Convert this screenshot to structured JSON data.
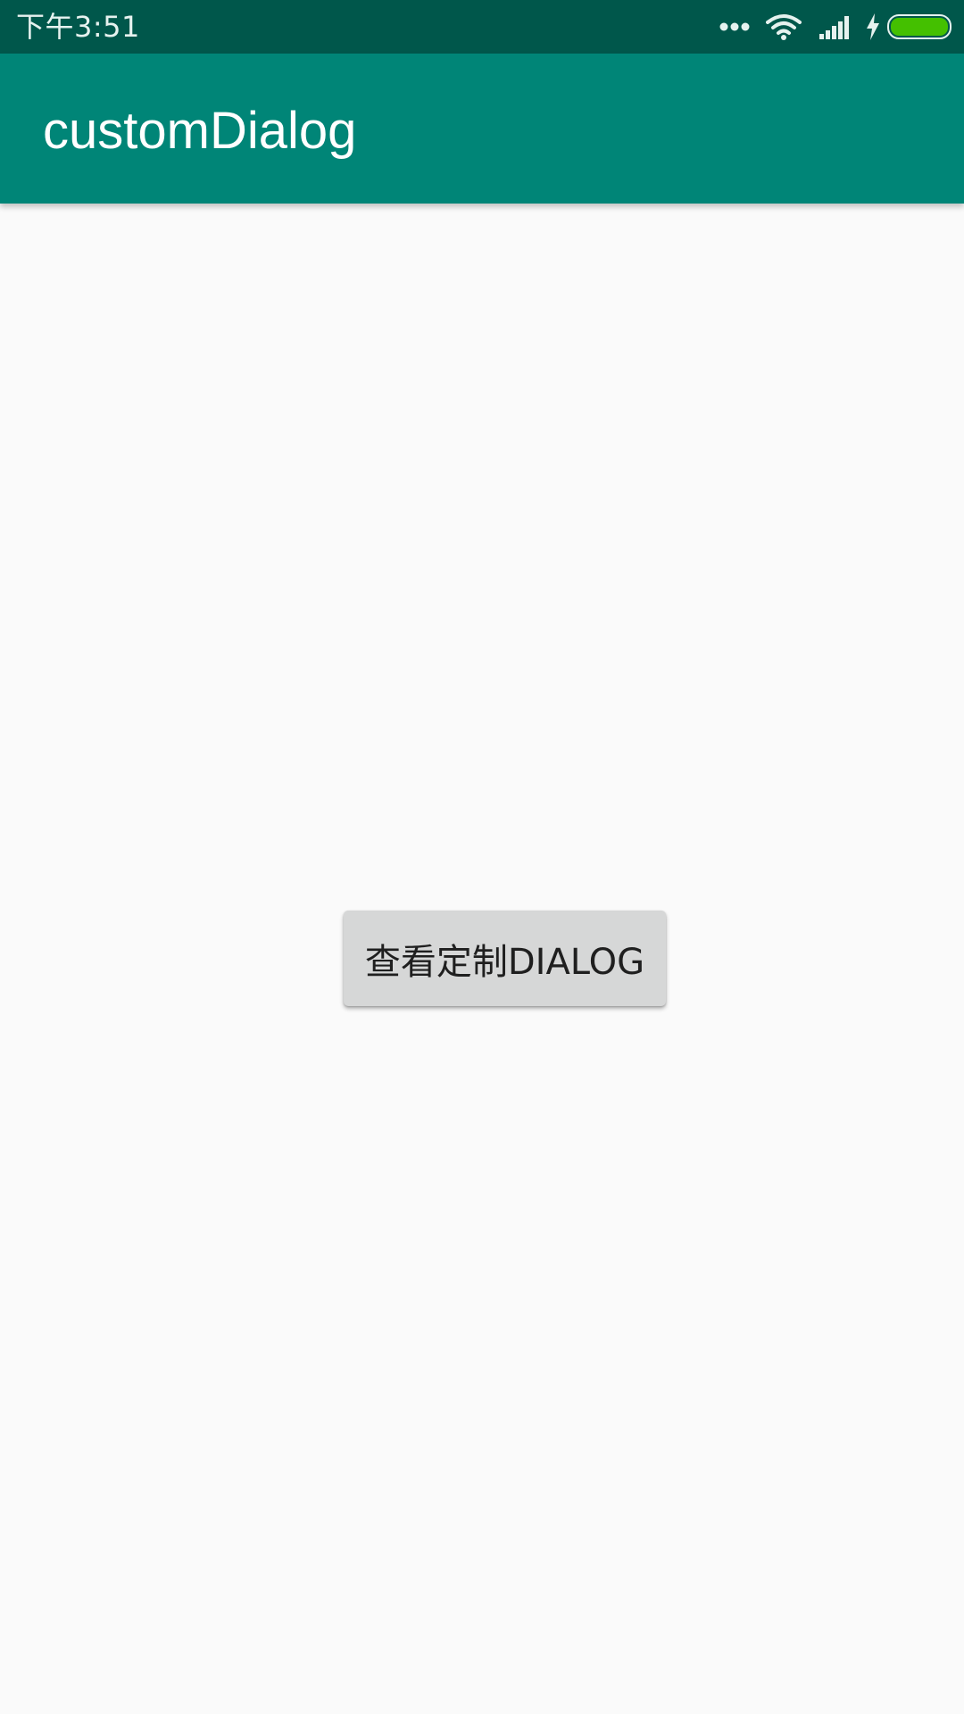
{
  "status_bar": {
    "time": "下午3:51",
    "icons": [
      "more-dots-icon",
      "wifi-icon",
      "signal-icon",
      "charging-icon",
      "battery-icon"
    ],
    "battery_color": "#44c000"
  },
  "app_bar": {
    "title": "customDialog",
    "background": "#008577"
  },
  "main": {
    "button_label": "查看定制DIALOG"
  },
  "colors": {
    "status_bar": "#00574b",
    "background": "#fafafa",
    "button": "#d6d7d7"
  }
}
